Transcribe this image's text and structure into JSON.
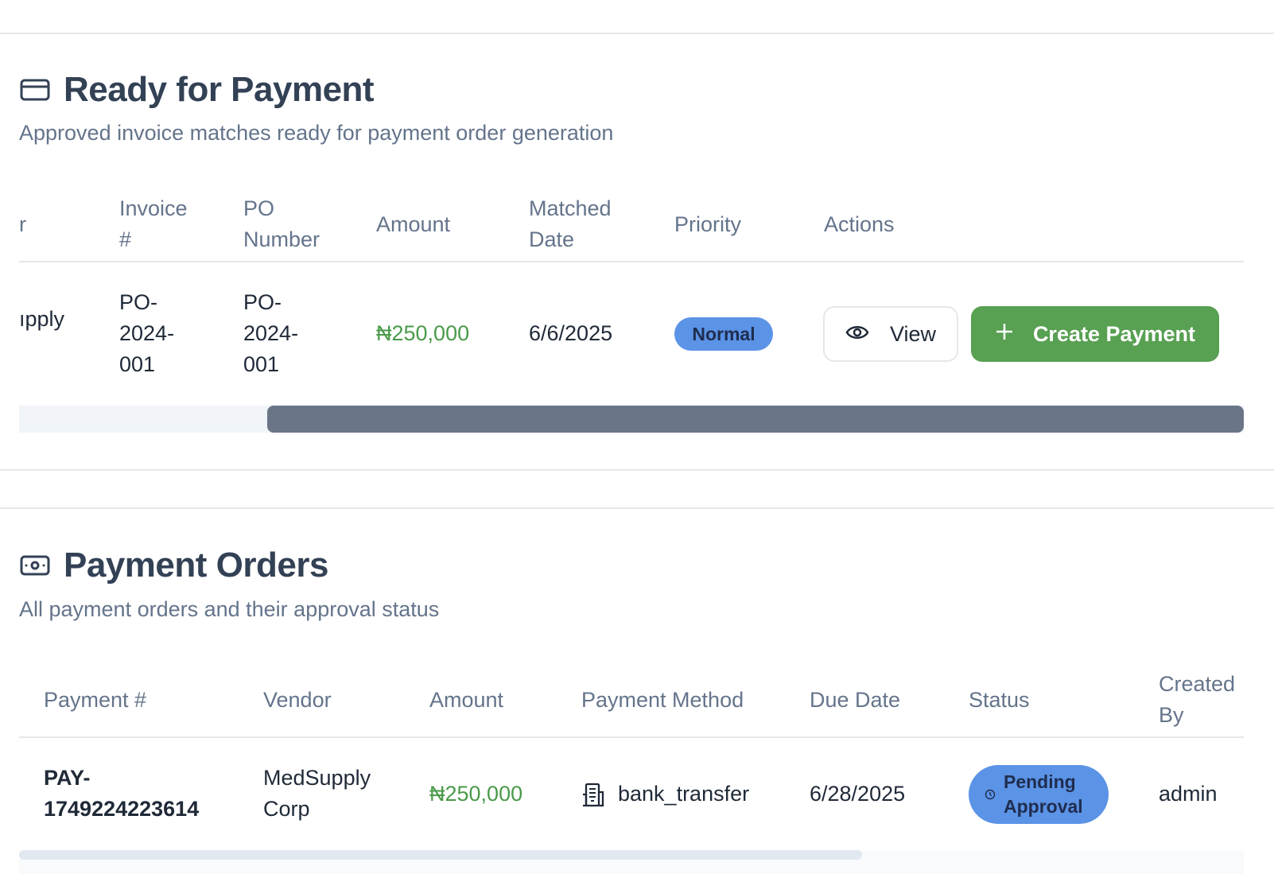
{
  "ready": {
    "title": "Ready for Payment",
    "description": "Approved invoice matches ready for payment order generation",
    "icon": "credit-card-icon",
    "headers": {
      "vendor_partial": "r",
      "invoice_line1": "Invoice",
      "invoice_line2": "#",
      "po_line1": "PO",
      "po_line2": "Number",
      "amount": "Amount",
      "matched_line1": "Matched",
      "matched_line2": "Date",
      "priority": "Priority",
      "actions": "Actions"
    },
    "row": {
      "vendor_partial": "ıpply",
      "invoice_l1": "PO-",
      "invoice_l2": "2024-",
      "invoice_l3": "001",
      "po_l1": "PO-",
      "po_l2": "2024-",
      "po_l3": "001",
      "amount": "₦250,000",
      "matched_date": "6/6/2025",
      "priority": "Normal",
      "view_label": "View",
      "create_label": "Create Payment"
    }
  },
  "orders": {
    "title": "Payment Orders",
    "description": "All payment orders and their approval status",
    "icon": "banknote-icon",
    "headers": {
      "payment_no": "Payment #",
      "vendor": "Vendor",
      "amount": "Amount",
      "method": "Payment Method",
      "due_date": "Due Date",
      "status": "Status",
      "created_line1": "Created",
      "created_line2": "By"
    },
    "row": {
      "payment_l1": "PAY-",
      "payment_l2": "1749224223614",
      "vendor_l1": "MedSupply",
      "vendor_l2": "Corp",
      "amount": "₦250,000",
      "method": "bank_transfer",
      "due_date": "6/28/2025",
      "status_l1": "Pending",
      "status_l2": "Approval",
      "created_by": "admin"
    }
  },
  "colors": {
    "accent_green": "#58a052",
    "amount_green": "#4a9a4a",
    "badge_blue": "#5b93e6"
  }
}
